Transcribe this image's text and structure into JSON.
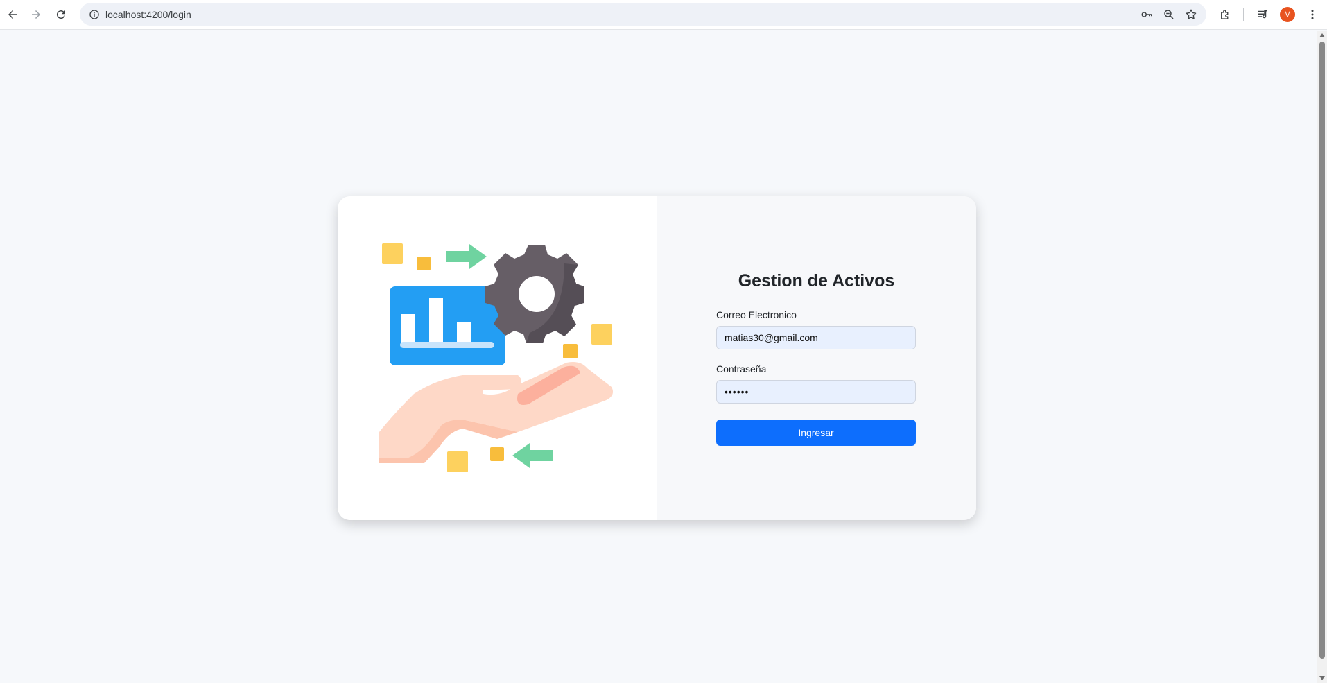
{
  "browser": {
    "url": "localhost:4200/login",
    "profile_initial": "M",
    "icons": [
      "back-icon",
      "forward-icon",
      "reload-icon",
      "site-info-icon",
      "password-key-icon",
      "zoom-icon",
      "bookmark-star-icon",
      "extensions-icon",
      "media-queue-icon",
      "menu-icon"
    ]
  },
  "login": {
    "title": "Gestion de Activos",
    "email_label": "Correo Electronico",
    "email_value": "matias30@gmail.com",
    "password_label": "Contraseña",
    "password_value": "••••••",
    "submit_label": "Ingresar"
  },
  "colors": {
    "accent": "#0d6efd",
    "page_bg": "#f6f8fb",
    "input_bg": "#e8f0fe",
    "avatar": "#e8531f"
  }
}
